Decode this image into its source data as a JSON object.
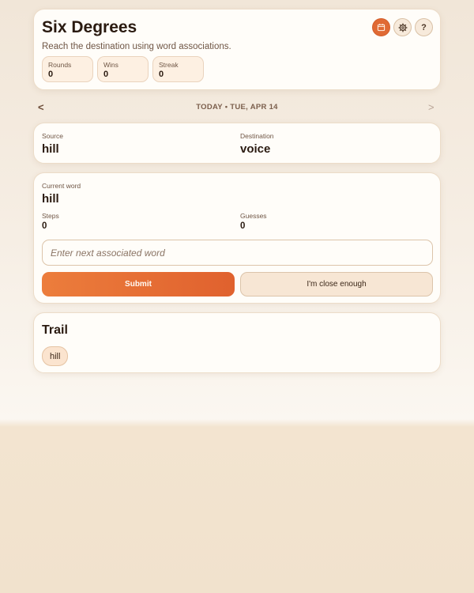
{
  "header": {
    "title": "Six Degrees",
    "subtitle": "Reach the destination using word associations.",
    "icons": [
      "calendar-icon",
      "gear-icon",
      "help-icon"
    ],
    "help_glyph": "?",
    "stats": [
      {
        "label": "Rounds",
        "value": "0"
      },
      {
        "label": "Wins",
        "value": "0"
      },
      {
        "label": "Streak",
        "value": "0"
      }
    ]
  },
  "date_nav": {
    "prev": "<",
    "label": "TODAY • TUE, APR 14",
    "next": ">"
  },
  "route": {
    "source_label": "Source",
    "source_word": "hill",
    "destination_label": "Destination",
    "destination_word": "voice"
  },
  "play": {
    "current_label": "Current word",
    "current_word": "hill",
    "steps_label": "Steps",
    "steps_value": "0",
    "guesses_label": "Guesses",
    "guesses_value": "0",
    "input_placeholder": "Enter next associated word",
    "input_value": "",
    "submit_label": "Submit",
    "close_label": "I'm close enough"
  },
  "trail": {
    "title": "Trail",
    "words": [
      "hill"
    ]
  },
  "colors": {
    "accent": "#e06a35",
    "background": "#f6eee4",
    "card": "#fffdf9",
    "text": "#2a1a10"
  }
}
